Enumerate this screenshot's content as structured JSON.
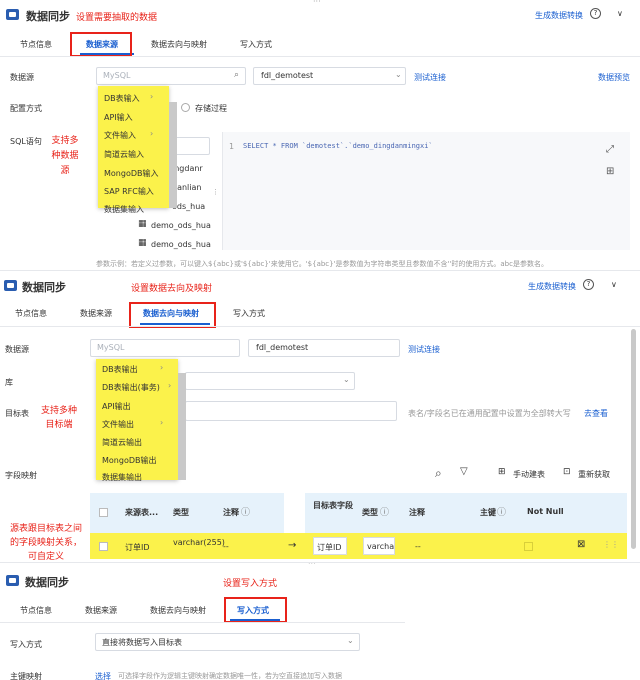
{
  "app": {
    "title": "数据同步",
    "convert_link": "生成数据转换",
    "help": "?",
    "collapse": "∨"
  },
  "tabs": [
    "节点信息",
    "数据来源",
    "数据去向与映射",
    "写入方式"
  ],
  "annotations": {
    "a1": "设置需要抽取的数据",
    "a2": "支持多种数据源",
    "a3": "设置数据去向及映射",
    "a4": "支持多种目标端",
    "a5": "源表跟目标表之间的字段映射关系，可自定义",
    "a6": "设置写入方式"
  },
  "source": {
    "datasource_label": "数据源",
    "select_placeholder": "MySQL",
    "connection": "fdl_demotest",
    "test_link": "测试连接",
    "preview_link": "数据预览",
    "config_label": "配置方式",
    "stored_proc": "存储过程",
    "sql_label": "SQL语句",
    "sql_text": "SELECT * FROM `demotest`.`demo_dingdanmingxi`",
    "line_no": "1",
    "tables_partial": [
      "ingdanr",
      "uanlian",
      "ods_hua"
    ],
    "tables": [
      "demo_ods_hua",
      "demo_ods_hua"
    ],
    "dropdown": [
      "DB表输入",
      "API输入",
      "文件输入",
      "简道云输入",
      "MongoDB输入",
      "SAP RFC输入",
      "数据集输入"
    ],
    "hint": "参数示例：若定义过参数，可以键入${abc}或'${abc}'来使用它。'${abc}'是参数值为字符串类型且参数值不含''时的使用方式。abc是参数名。"
  },
  "dest": {
    "datasource_label": "数据源",
    "select_placeholder": "MySQL",
    "connection": "fdl_demotest",
    "test_link": "测试连接",
    "db_label": "库",
    "table_label": "目标表",
    "table_hint": "表名/字段名已在通用配置中设置为全部转大写",
    "view_link": "去查看",
    "mapping_label": "字段映射",
    "manual_create": "手动建表",
    "refetch": "重新获取",
    "dropdown": [
      "DB表输出",
      "DB表输出(事务)",
      "API输出",
      "文件输出",
      "简道云输出",
      "MongoDB输出",
      "数据集输出"
    ],
    "src_headers": [
      "来源表...",
      "类型",
      "注释"
    ],
    "dst_headers": [
      "目标表字段",
      "类型",
      "注释",
      "主键",
      "Not Null"
    ],
    "row": {
      "src_field": "订单ID",
      "src_type": "varchar(255)",
      "src_comment": "--",
      "arrow": "→",
      "dst_field": "订单ID",
      "dst_type": "varcha",
      "dst_comment": "--"
    }
  },
  "write": {
    "mode_label": "写入方式",
    "mode_value": "直接将数据写入目标表",
    "pk_label": "主键映射",
    "pk_link": "选择",
    "pk_hint": "可选择字段作为逻辑主键映射确定数据唯一性，若为空直接追加写入数据"
  }
}
